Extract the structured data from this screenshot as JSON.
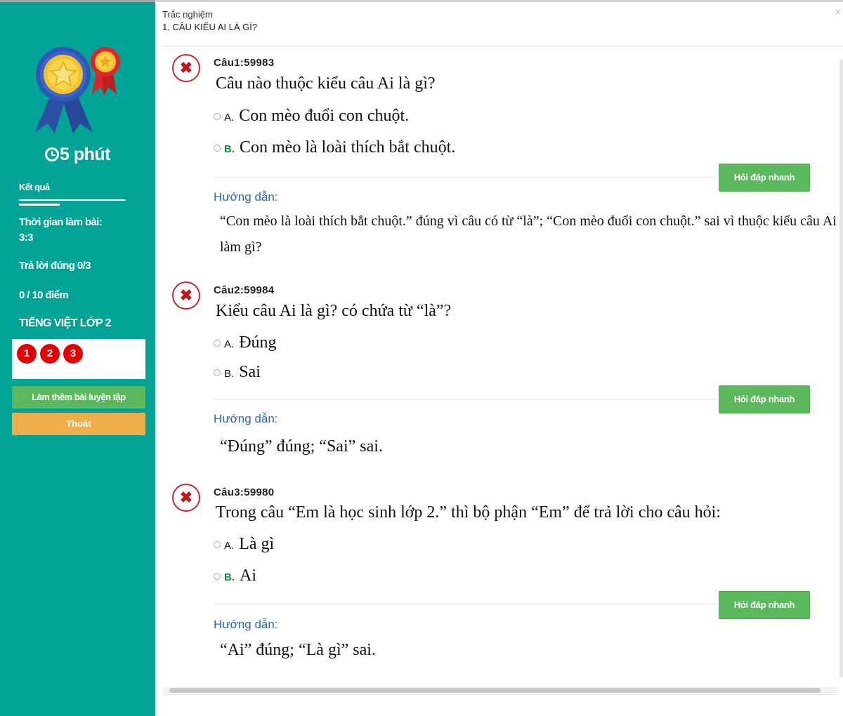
{
  "header": {
    "subtitle": "Trắc nghiệm",
    "title": "1. CÂU KIỂU AI LÀ GÌ?",
    "close_icon": "close-icon"
  },
  "sidebar": {
    "timer": "5 phút",
    "result_title": "Kết quả",
    "time_label": "Thời gian làm bài:",
    "time_value": "3:3",
    "correct": "Trả lời đúng 0/3",
    "score": "0 / 10 điểm",
    "subject": "TIẾNG VIỆT LỚP 2",
    "question_numbers": [
      "1",
      "2",
      "3"
    ],
    "practice_button": "Làm thêm bài luyện tập",
    "exit_button": "Thoát",
    "colors": {
      "background": "#00a496",
      "wrong_dot": "#e30000",
      "practice": "#5cb85c",
      "exit": "#f0ad4e"
    }
  },
  "questions": [
    {
      "code": "Câu1:59983",
      "text": "Câu nào thuộc kiểu câu Ai là gì?",
      "options": [
        {
          "letter": "A.",
          "text": "Con mèo đuổi con chuột."
        },
        {
          "letter": "B.",
          "text": "Con mèo là loài thích bắt chuột."
        }
      ],
      "ask_button": "Hỏi đáp nhanh",
      "guide_label": "Hướng dẫn:",
      "explanation": "“Con mèo là loài thích bắt chuột.” đúng vì câu có từ “là”; “Con mèo đuổi con chuột.” sai vì thuộc kiểu câu Ai làm gì?"
    },
    {
      "code": "Câu2:59984",
      "text": "Kiểu câu Ai là gì? có chứa từ “là”?",
      "options": [
        {
          "letter": "A.",
          "text": "Đúng"
        },
        {
          "letter": "B.",
          "text": "Sai"
        }
      ],
      "ask_button": "Hỏi đáp nhanh",
      "guide_label": "Hướng dẫn:",
      "explanation": "“Đúng” đúng; “Sai” sai."
    },
    {
      "code": "Câu3:59980",
      "text": "Trong câu “Em là học sinh lớp 2.” thì bộ phận “Em” để trả lời cho câu hỏi:",
      "options": [
        {
          "letter": "A.",
          "text": "Là gì"
        },
        {
          "letter": "B.",
          "text": "Ai"
        }
      ],
      "ask_button": "Hỏi đáp nhanh",
      "guide_label": "Hướng dẫn:",
      "explanation": "“Ai” đúng; “Là gì” sai."
    }
  ],
  "colors": {
    "guide_text": "#2b6aa4",
    "wrong_icon": "#c0161d",
    "ask_button": "#5cb85c"
  }
}
